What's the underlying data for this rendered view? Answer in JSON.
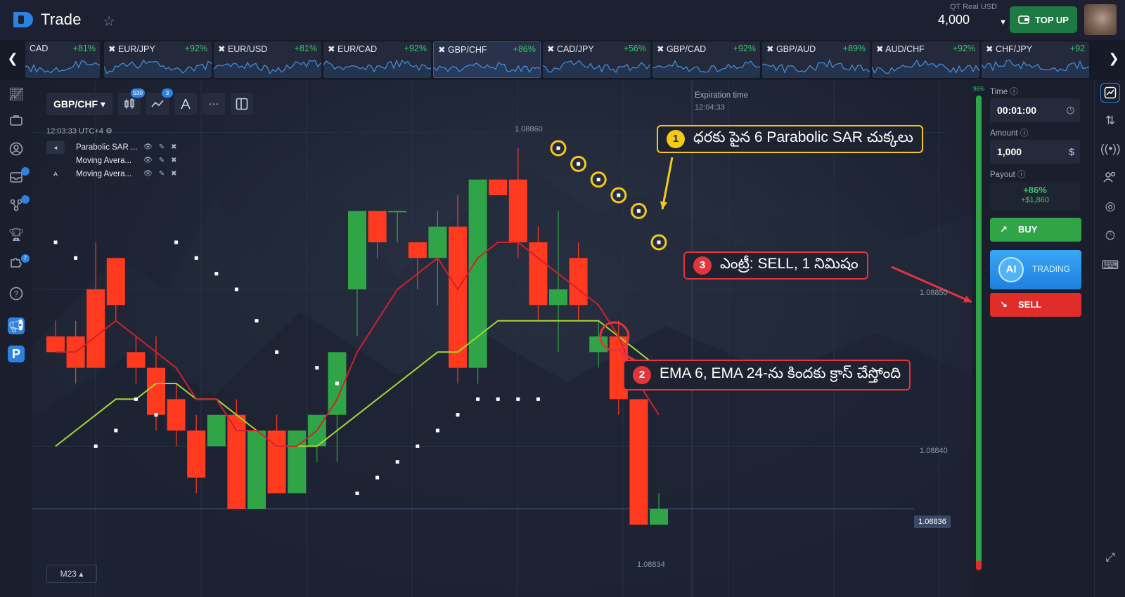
{
  "app": {
    "name": "Trade"
  },
  "account": {
    "label": "QT Real  USD",
    "balance": "4,000"
  },
  "topup": {
    "label": "TOP UP"
  },
  "tickers": [
    {
      "name": "CAD",
      "pct": "+81%"
    },
    {
      "name": "EUR/JPY",
      "pct": "+92%"
    },
    {
      "name": "EUR/USD",
      "pct": "+81%"
    },
    {
      "name": "EUR/CAD",
      "pct": "+92%"
    },
    {
      "name": "GBP/CHF",
      "pct": "+86%",
      "active": true
    },
    {
      "name": "CAD/JPY",
      "pct": "+56%"
    },
    {
      "name": "GBP/CAD",
      "pct": "+92%"
    },
    {
      "name": "GBP/AUD",
      "pct": "+89%"
    },
    {
      "name": "AUD/CHF",
      "pct": "+92%"
    },
    {
      "name": "CHF/JPY",
      "pct": "+92"
    }
  ],
  "chart_toolbar": {
    "pair": "GBP/CHF",
    "badge_candles": "S30",
    "badge_indicators": "3"
  },
  "clock": "12:03:33 UTC+4",
  "indicators": [
    {
      "name": "Parabolic SAR ...",
      "toggle": "◂"
    },
    {
      "name": "Moving Avera...",
      "toggle": ""
    },
    {
      "name": "Moving Avera...",
      "toggle": "A"
    }
  ],
  "expiration": {
    "label": "Expiration time",
    "value": "12:04:33"
  },
  "timeframe": "M23",
  "price_labels": {
    "top": "1.08860",
    "p850": "1.08850",
    "p840": "1.08840",
    "current": "1.08836",
    "bottom": "1.08834"
  },
  "callouts": [
    {
      "num": "1",
      "text": "ధరకు పైన 6 Parabolic SAR చుక్కలు"
    },
    {
      "num": "2",
      "text": "EMA 6, EMA 24-ను కిందకు క్రాస్ చేస్తోంది"
    },
    {
      "num": "3",
      "text": "ఎంట్రీ: SELL, 1 నిమిషం"
    }
  ],
  "trade_panel": {
    "time_label": "Time ⓘ",
    "time_value": "00:01:00",
    "amount_label": "Amount ⓘ",
    "amount_value": "1,000",
    "payout_label": "Payout ⓘ",
    "payout_pct": "+86%",
    "payout_amount": "+$1,860",
    "buy_label": "BUY",
    "ai_label": "AI",
    "ai_text": "TRADING",
    "sell_label": "SELL",
    "scale_pct": "96%"
  },
  "colors": {
    "bull": "#2fa548",
    "bear": "#ff3a1f",
    "ema6": "#d0202a",
    "ema24": "#a6d82f",
    "callout_yellow": "#f5c916",
    "callout_red": "#e4343c"
  },
  "chart_data": {
    "type": "candlestick",
    "pair": "GBP/CHF",
    "candles": [
      {
        "o": 1.08847,
        "h": 1.08848,
        "l": 1.08846,
        "c": 1.08846
      },
      {
        "o": 1.08847,
        "h": 1.08848,
        "l": 1.08844,
        "c": 1.08845
      },
      {
        "o": 1.0885,
        "h": 1.08853,
        "l": 1.08845,
        "c": 1.08845
      },
      {
        "o": 1.08852,
        "h": 1.08852,
        "l": 1.08848,
        "c": 1.08849
      },
      {
        "o": 1.08846,
        "h": 1.08847,
        "l": 1.08844,
        "c": 1.08845
      },
      {
        "o": 1.08845,
        "h": 1.08847,
        "l": 1.08841,
        "c": 1.08842
      },
      {
        "o": 1.08843,
        "h": 1.08844,
        "l": 1.0884,
        "c": 1.08841
      },
      {
        "o": 1.08841,
        "h": 1.08842,
        "l": 1.08837,
        "c": 1.08838
      },
      {
        "o": 1.0884,
        "h": 1.08842,
        "l": 1.0884,
        "c": 1.08842
      },
      {
        "o": 1.08842,
        "h": 1.08843,
        "l": 1.08836,
        "c": 1.08836
      },
      {
        "o": 1.08836,
        "h": 1.08841,
        "l": 1.08836,
        "c": 1.08841
      },
      {
        "o": 1.08841,
        "h": 1.08842,
        "l": 1.08837,
        "c": 1.08837
      },
      {
        "o": 1.08837,
        "h": 1.08841,
        "l": 1.08837,
        "c": 1.08841
      },
      {
        "o": 1.0884,
        "h": 1.08842,
        "l": 1.08839,
        "c": 1.08842
      },
      {
        "o": 1.08842,
        "h": 1.08845,
        "l": 1.08839,
        "c": 1.08846
      },
      {
        "o": 1.0885,
        "h": 1.08855,
        "l": 1.08847,
        "c": 1.08855
      },
      {
        "o": 1.08855,
        "h": 1.08855,
        "l": 1.08852,
        "c": 1.08853
      },
      {
        "o": 1.08855,
        "h": 1.08855,
        "l": 1.08853,
        "c": 1.08855
      },
      {
        "o": 1.08853,
        "h": 1.08853,
        "l": 1.0885,
        "c": 1.08852
      },
      {
        "o": 1.08852,
        "h": 1.08855,
        "l": 1.08849,
        "c": 1.08854
      },
      {
        "o": 1.08854,
        "h": 1.08856,
        "l": 1.08844,
        "c": 1.08845
      },
      {
        "o": 1.08845,
        "h": 1.08857,
        "l": 1.08844,
        "c": 1.08857
      },
      {
        "o": 1.08857,
        "h": 1.08857,
        "l": 1.08856,
        "c": 1.08856
      },
      {
        "o": 1.08857,
        "h": 1.08859,
        "l": 1.08852,
        "c": 1.08853
      },
      {
        "o": 1.08853,
        "h": 1.08854,
        "l": 1.08848,
        "c": 1.08849
      },
      {
        "o": 1.08849,
        "h": 1.08855,
        "l": 1.08846,
        "c": 1.0885
      },
      {
        "o": 1.08852,
        "h": 1.08853,
        "l": 1.08848,
        "c": 1.08849
      },
      {
        "o": 1.08846,
        "h": 1.08848,
        "l": 1.08845,
        "c": 1.08847
      },
      {
        "o": 1.08847,
        "h": 1.08848,
        "l": 1.08842,
        "c": 1.08843
      },
      {
        "o": 1.08843,
        "h": 1.08843,
        "l": 1.08835,
        "c": 1.08835
      },
      {
        "o": 1.08835,
        "h": 1.08837,
        "l": 1.08835,
        "c": 1.08836
      }
    ],
    "ema6": [
      1.08846,
      1.08846,
      1.08847,
      1.08848,
      1.08847,
      1.08846,
      1.08845,
      1.08843,
      1.08843,
      1.08841,
      1.08841,
      1.0884,
      1.0884,
      1.08841,
      1.08843,
      1.08846,
      1.08848,
      1.0885,
      1.08851,
      1.08852,
      1.0885,
      1.08852,
      1.08853,
      1.08853,
      1.08852,
      1.08851,
      1.0885,
      1.08849,
      1.08847,
      1.08844,
      1.08842
    ],
    "ema24": [
      1.0884,
      1.08841,
      1.08842,
      1.08843,
      1.08843,
      1.08844,
      1.08844,
      1.08843,
      1.08843,
      1.08842,
      1.08841,
      1.0884,
      1.0884,
      1.0884,
      1.08841,
      1.08842,
      1.08843,
      1.08844,
      1.08845,
      1.08846,
      1.08846,
      1.08847,
      1.08848,
      1.08848,
      1.08848,
      1.08848,
      1.08848,
      1.08848,
      1.08847,
      1.08846,
      1.08845
    ],
    "sar": [
      {
        "i": 0,
        "v": 1.08853
      },
      {
        "i": 1,
        "v": 1.08852
      },
      {
        "i": 2,
        "v": 1.0884
      },
      {
        "i": 3,
        "v": 1.08841
      },
      {
        "i": 4,
        "v": 1.08843
      },
      {
        "i": 5,
        "v": 1.08842
      },
      {
        "i": 6,
        "v": 1.08853
      },
      {
        "i": 7,
        "v": 1.08852
      },
      {
        "i": 8,
        "v": 1.08851
      },
      {
        "i": 9,
        "v": 1.0885
      },
      {
        "i": 10,
        "v": 1.08848
      },
      {
        "i": 11,
        "v": 1.08846
      },
      {
        "i": 13,
        "v": 1.08845
      },
      {
        "i": 14,
        "v": 1.08844
      },
      {
        "i": 15,
        "v": 1.08837
      },
      {
        "i": 16,
        "v": 1.08838
      },
      {
        "i": 17,
        "v": 1.08839
      },
      {
        "i": 18,
        "v": 1.0884
      },
      {
        "i": 19,
        "v": 1.08841
      },
      {
        "i": 20,
        "v": 1.08842
      },
      {
        "i": 21,
        "v": 1.08843
      },
      {
        "i": 22,
        "v": 1.08843
      },
      {
        "i": 23,
        "v": 1.08843
      },
      {
        "i": 24,
        "v": 1.08843
      },
      {
        "i": 25,
        "v": 1.08859
      },
      {
        "i": 26,
        "v": 1.08858
      },
      {
        "i": 27,
        "v": 1.08857
      },
      {
        "i": 28,
        "v": 1.08856
      },
      {
        "i": 29,
        "v": 1.08855
      },
      {
        "i": 30,
        "v": 1.08853
      }
    ],
    "highlighted_sar": [
      25,
      26,
      27,
      28,
      29,
      30
    ],
    "current_price": 1.08836,
    "ylim": [
      1.08832,
      1.08862
    ]
  }
}
